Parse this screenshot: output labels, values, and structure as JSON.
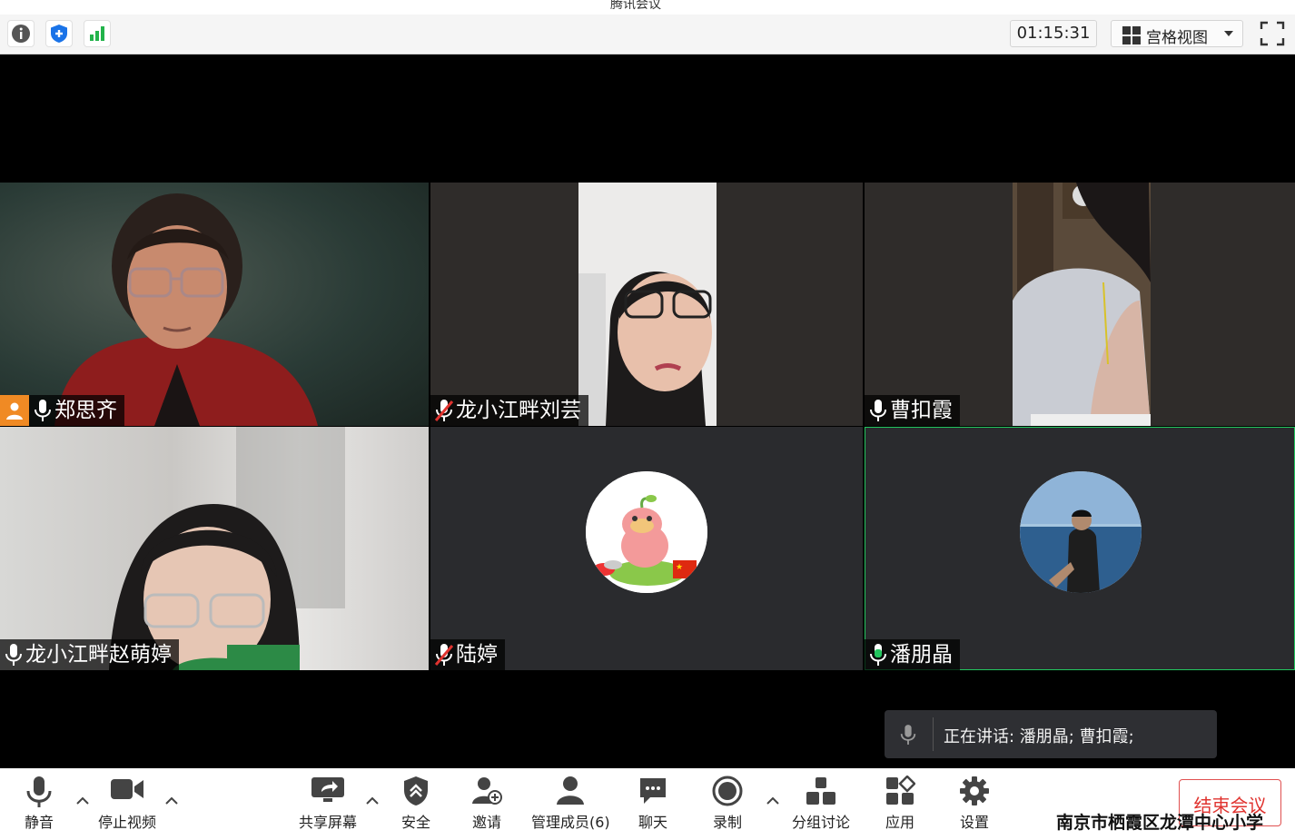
{
  "window": {
    "title": "腾讯会议"
  },
  "topbar": {
    "timer": "01:15:31",
    "view_label": "宫格视图"
  },
  "participants": [
    {
      "name": "郑思齐",
      "host": true,
      "mic": "on"
    },
    {
      "name": "龙小江畔刘芸",
      "host": false,
      "mic": "muted"
    },
    {
      "name": "曹扣霞",
      "host": false,
      "mic": "on"
    },
    {
      "name": "龙小江畔赵萌婷",
      "host": false,
      "mic": "on"
    },
    {
      "name": "陆婷",
      "host": false,
      "mic": "muted"
    },
    {
      "name": "潘朋晶",
      "host": false,
      "mic": "speaking"
    }
  ],
  "speaking": {
    "text": "正在讲话: 潘朋晶; 曹扣霞;"
  },
  "toolbar": {
    "mute": "静音",
    "stop_video": "停止视频",
    "share_screen": "共享屏幕",
    "security": "安全",
    "invite": "邀请",
    "manage_members": "管理成员(6)",
    "chat": "聊天",
    "record": "录制",
    "breakout": "分组讨论",
    "apps": "应用",
    "settings": "设置",
    "end_meeting": "结束会议"
  },
  "watermark": "南京市栖霞区龙潭中心小学",
  "colors": {
    "host_badge": "#f08a24",
    "speaking_green": "#22c55e",
    "end_red": "#e0332f",
    "accent_blue": "#1a73e8"
  }
}
